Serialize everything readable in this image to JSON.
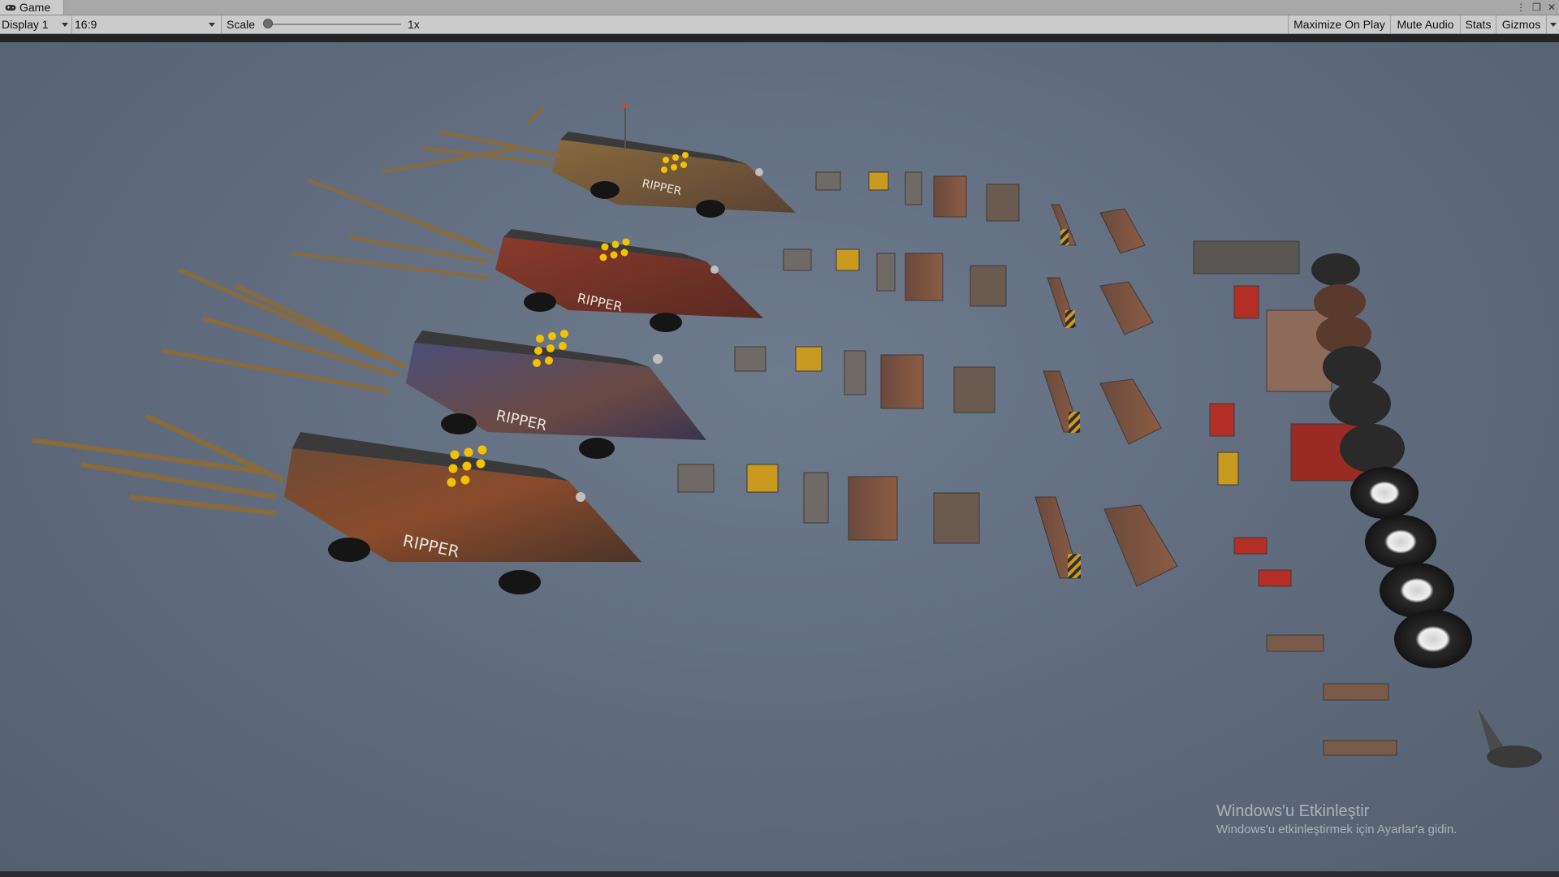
{
  "window": {
    "tab_label": "Game",
    "tab_icon": "gamepad-icon",
    "menu_icon": "kebab-menu-icon",
    "maximize_icon": "maximize-window-icon",
    "close_icon": "close-icon"
  },
  "toolbar": {
    "display": "Display 1",
    "aspect": "16:9",
    "scale_label": "Scale",
    "scale_value": "1x",
    "scale_fraction": 0.0,
    "buttons": {
      "maximize_on_play": "Maximize On Play",
      "mute_audio": "Mute Audio",
      "stats": "Stats",
      "gizmos": "Gizmos"
    }
  },
  "scene": {
    "car_decals": [
      "RIPPER",
      "RIPPER",
      "RIPPER",
      "RIPPER"
    ],
    "colors": {
      "background": "#5f6b7c",
      "rust": "#8a4b2c",
      "lights": "#f2c200"
    }
  },
  "watermark": {
    "title": "Windows'u Etkinleştir",
    "subtitle": "Windows'u etkinleştirmek için Ayarlar'a gidin."
  }
}
